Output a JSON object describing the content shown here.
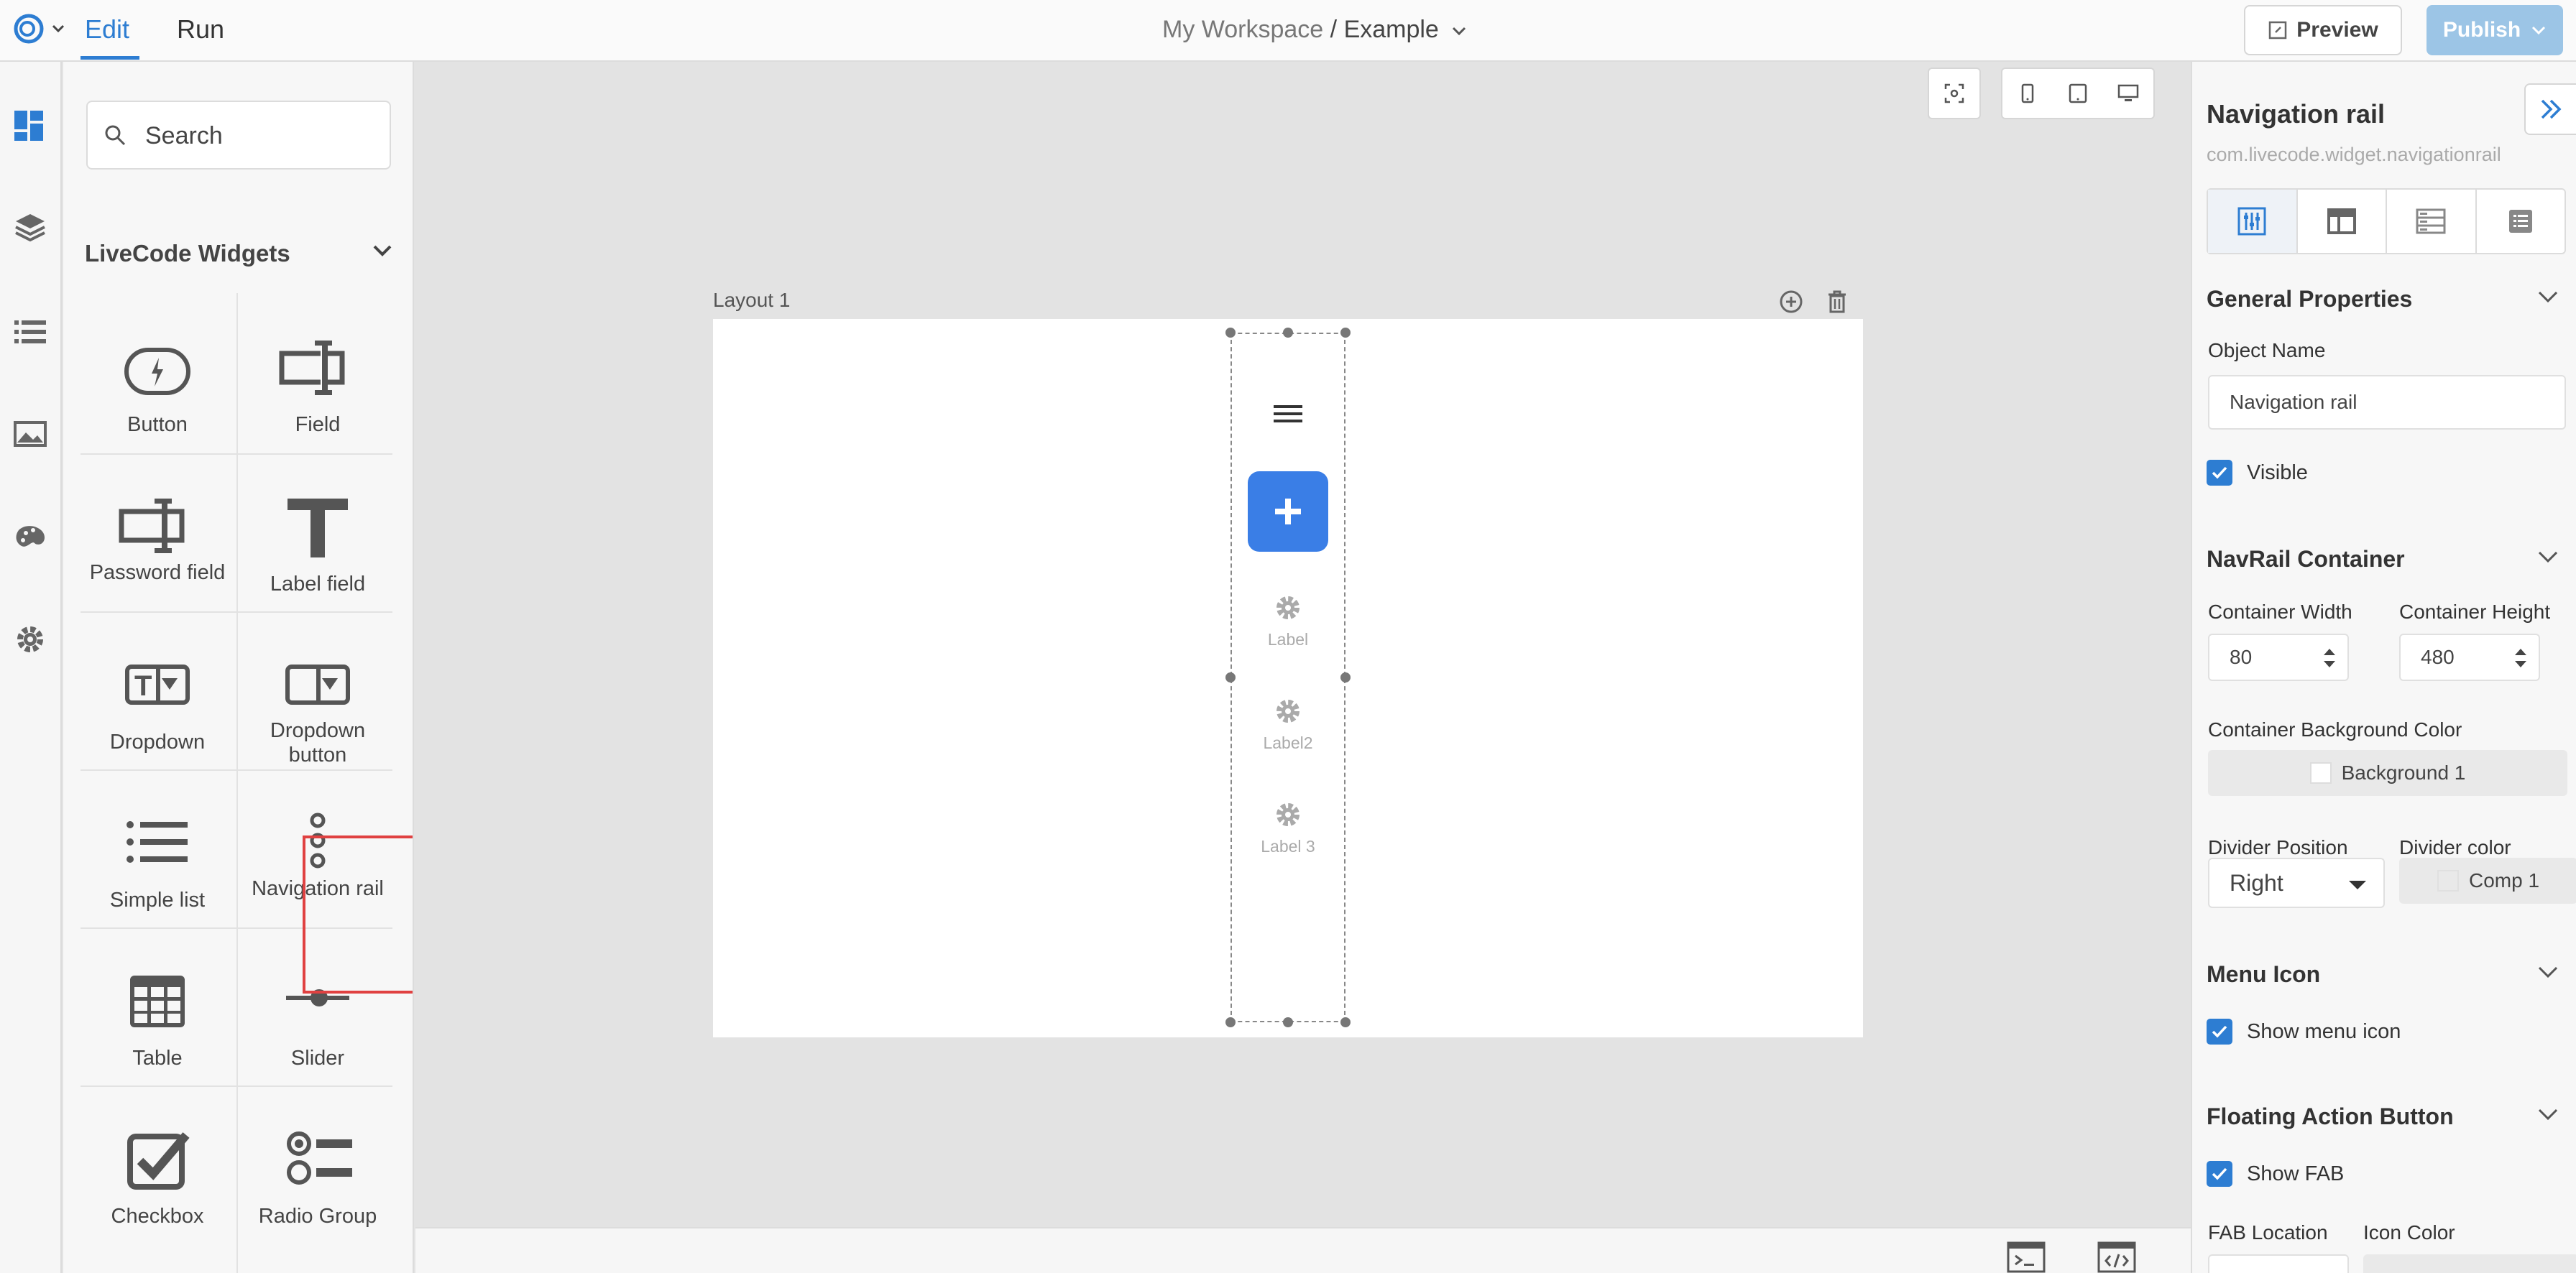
{
  "topbar": {
    "tabs": [
      {
        "label": "Edit"
      },
      {
        "label": "Run"
      }
    ],
    "workspace": "My Workspace",
    "project": "/ Example",
    "preview_label": "Preview",
    "publish_label": "Publish"
  },
  "accent_color": "#2d7dd2",
  "sidebar": {
    "search_placeholder": "Search",
    "group_title": "LiveCode Widgets",
    "widgets": [
      {
        "label": "Button",
        "icon": "button-widget-icon"
      },
      {
        "label": "Field",
        "icon": "field-widget-icon"
      },
      {
        "label": "Password field",
        "icon": "password-field-icon"
      },
      {
        "label": "Label field",
        "icon": "label-field-icon"
      },
      {
        "label": "Dropdown",
        "icon": "dropdown-icon"
      },
      {
        "label": "Dropdown button",
        "icon": "dropdown-button-icon"
      },
      {
        "label": "Simple list",
        "icon": "simple-list-icon"
      },
      {
        "label": "Navigation rail",
        "icon": "navigation-rail-icon",
        "selected": true
      },
      {
        "label": "Table",
        "icon": "table-icon"
      },
      {
        "label": "Slider",
        "icon": "slider-icon"
      },
      {
        "label": "Checkbox",
        "icon": "checkbox-icon"
      },
      {
        "label": "Radio Group",
        "icon": "radio-group-icon"
      }
    ]
  },
  "canvas": {
    "layout_label": "Layout 1",
    "nav_items": [
      {
        "label": "Label"
      },
      {
        "label": "Label2"
      },
      {
        "label": "Label 3"
      }
    ]
  },
  "properties": {
    "title": "Navigation rail",
    "widget_id": "com.livecode.widget.navigationrail",
    "sections": {
      "general": "General Properties",
      "container": "NavRail Container",
      "menu_icon": "Menu Icon",
      "fab": "Floating Action Button"
    },
    "object_name_label": "Object Name",
    "object_name_value": "Navigation rail",
    "visible_label": "Visible",
    "visible": true,
    "container_width_label": "Container Width",
    "container_width": "80",
    "container_height_label": "Container Height",
    "container_height": "480",
    "bg_color_label": "Container Background Color",
    "bg_color_value": "Background 1",
    "divider_position_label": "Divider Position",
    "divider_position": "Right",
    "divider_color_label": "Divider color",
    "divider_color_value": "Comp 1",
    "show_menu_icon_label": "Show menu icon",
    "show_fab_label": "Show FAB",
    "fab_location_label": "FAB Location",
    "icon_color_label": "Icon Color"
  }
}
